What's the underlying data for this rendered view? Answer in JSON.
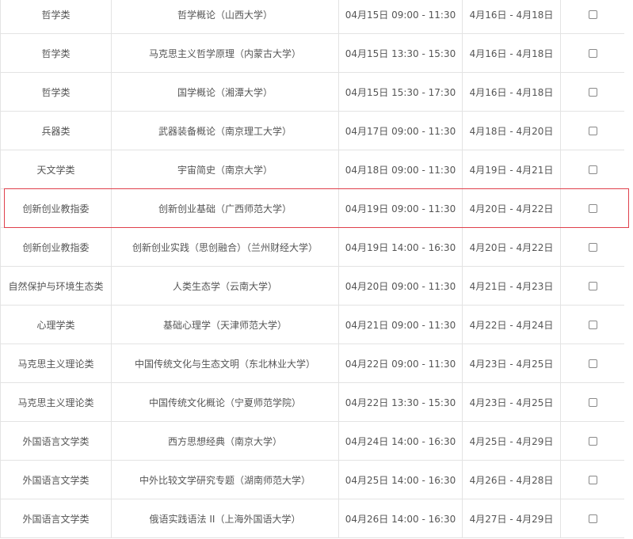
{
  "table": {
    "rows": [
      {
        "category": "哲学类",
        "course": "哲学概论（山西大学）",
        "exam_time": "04月15日 09:00 - 11:30",
        "dates": "4月16日 - 4月18日"
      },
      {
        "category": "哲学类",
        "course": "马克思主义哲学原理（内蒙古大学）",
        "exam_time": "04月15日 13:30 - 15:30",
        "dates": "4月16日 - 4月18日"
      },
      {
        "category": "哲学类",
        "course": "国学概论（湘潭大学）",
        "exam_time": "04月15日 15:30 - 17:30",
        "dates": "4月16日 - 4月18日"
      },
      {
        "category": "兵器类",
        "course": "武器装备概论（南京理工大学）",
        "exam_time": "04月17日 09:00 - 11:30",
        "dates": "4月18日 - 4月20日"
      },
      {
        "category": "天文学类",
        "course": "宇宙简史（南京大学）",
        "exam_time": "04月18日 09:00 - 11:30",
        "dates": "4月19日 - 4月21日"
      },
      {
        "category": "创新创业教指委",
        "course": "创新创业基础（广西师范大学）",
        "exam_time": "04月19日 09:00 - 11:30",
        "dates": "4月20日 - 4月22日"
      },
      {
        "category": "创新创业教指委",
        "course": "创新创业实践（思创融合）（兰州财经大学）",
        "exam_time": "04月19日 14:00 - 16:30",
        "dates": "4月20日 - 4月22日"
      },
      {
        "category": "自然保护与环境生态类",
        "course": "人类生态学（云南大学）",
        "exam_time": "04月20日 09:00 - 11:30",
        "dates": "4月21日 - 4月23日"
      },
      {
        "category": "心理学类",
        "course": "基础心理学（天津师范大学）",
        "exam_time": "04月21日 09:00 - 11:30",
        "dates": "4月22日 - 4月24日"
      },
      {
        "category": "马克思主义理论类",
        "course": "中国传统文化与生态文明（东北林业大学）",
        "exam_time": "04月22日 09:00 - 11:30",
        "dates": "4月23日 - 4月25日"
      },
      {
        "category": "马克思主义理论类",
        "course": "中国传统文化概论（宁夏师范学院）",
        "exam_time": "04月22日 13:30 - 15:30",
        "dates": "4月23日 - 4月25日"
      },
      {
        "category": "外国语言文学类",
        "course": "西方思想经典（南京大学）",
        "exam_time": "04月24日 14:00 - 16:30",
        "dates": "4月25日 - 4月29日"
      },
      {
        "category": "外国语言文学类",
        "course": "中外比较文学研究专题（湖南师范大学）",
        "exam_time": "04月25日 14:00 - 16:30",
        "dates": "4月26日 - 4月28日"
      },
      {
        "category": "外国语言文学类",
        "course": "俄语实践语法 II（上海外国语大学）",
        "exam_time": "04月26日 14:00 - 16:30",
        "dates": "4月27日 - 4月29日"
      }
    ]
  },
  "highlight": {
    "color": "#e0404c"
  },
  "colors": {
    "text": "#555555",
    "border": "#e3e3e3"
  }
}
